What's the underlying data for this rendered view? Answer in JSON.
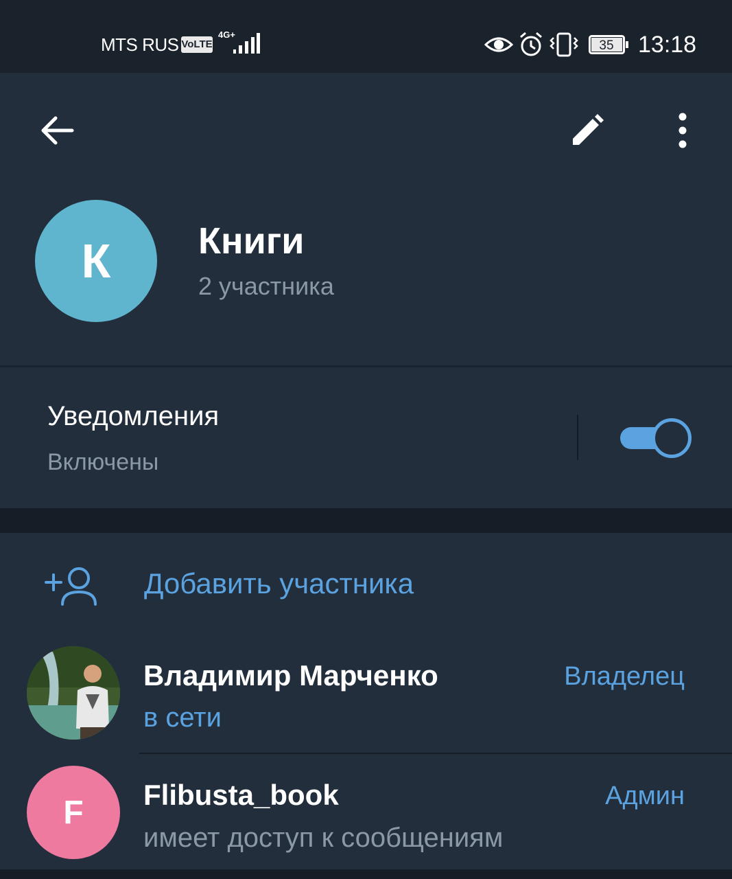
{
  "status_bar": {
    "carrier": "MTS RUS",
    "volte": "VoLTE",
    "network": "4G+",
    "battery": "35",
    "time": "13:18"
  },
  "toolbar": {
    "back_icon": "arrow-left-icon",
    "edit_icon": "pencil-icon",
    "more_icon": "more-vertical-icon"
  },
  "group": {
    "avatar_letter": "К",
    "avatar_color": "#5fb5cd",
    "title": "Книги",
    "subtitle": "2 участника"
  },
  "notifications": {
    "label": "Уведомления",
    "value": "Включены",
    "enabled": true,
    "accent": "#5ba3e0"
  },
  "members": {
    "add_label": "Добавить участника",
    "add_icon": "add-user-icon",
    "list": [
      {
        "name": "Владимир Марченко",
        "status": "в сети",
        "role": "Владелец",
        "avatar": "photo"
      },
      {
        "name": "Flibusta_book",
        "status": "имеет доступ к сообщениям",
        "role": "Админ",
        "avatar_letter": "F",
        "avatar_color": "#ee7aa0"
      }
    ]
  }
}
